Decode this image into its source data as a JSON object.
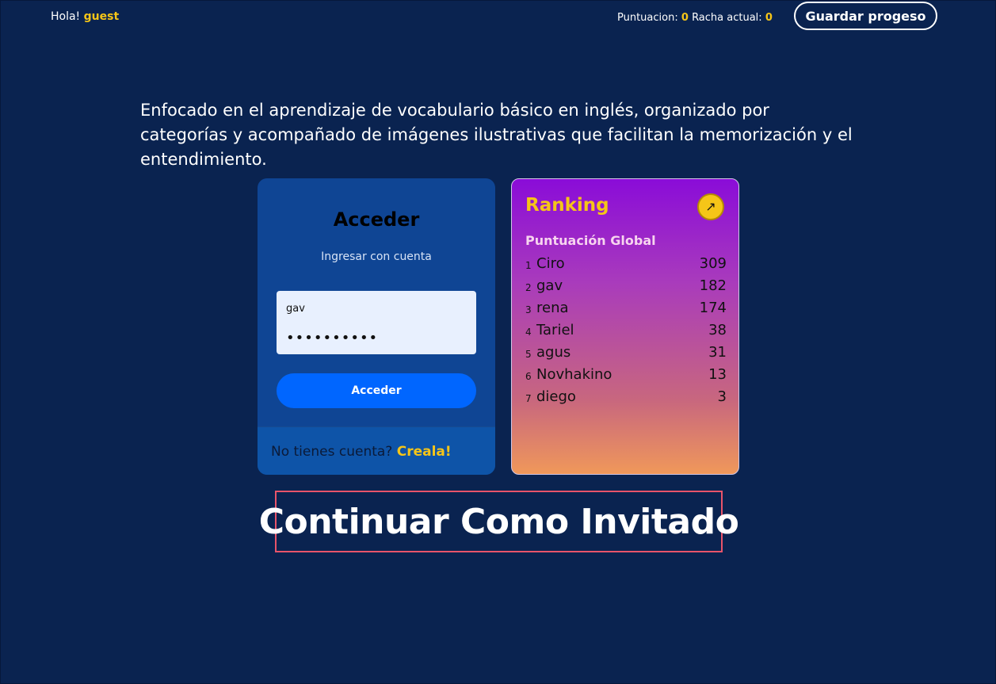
{
  "header": {
    "greeting_prefix": "Hola!",
    "username": "guest",
    "score_label": "Puntuacion:",
    "score_value": "0",
    "streak_label": "Racha actual:",
    "streak_value": "0",
    "save_label": "Guardar progeso"
  },
  "intro": {
    "text": "Enfocado en el aprendizaje de vocabulario básico en inglés, organizado por categorías y acompañado de imágenes ilustrativas que facilitan la memorización y el entendimiento."
  },
  "login": {
    "title": "Acceder",
    "subtitle": "Ingresar con cuenta",
    "username_value": "gav",
    "password_value": "••••••••••",
    "submit_label": "Acceder",
    "footer_text": "No tienes cuenta?",
    "footer_link": "Creala!"
  },
  "ranking": {
    "title": "Ranking",
    "open_icon": "arrow-up-right-icon",
    "subtitle": "Puntuación Global",
    "entries": [
      {
        "pos": "1",
        "name": "Ciro",
        "score": "309"
      },
      {
        "pos": "2",
        "name": "gav",
        "score": "182"
      },
      {
        "pos": "3",
        "name": "rena",
        "score": "174"
      },
      {
        "pos": "4",
        "name": "Tariel",
        "score": "38"
      },
      {
        "pos": "5",
        "name": "agus",
        "score": "31"
      },
      {
        "pos": "6",
        "name": "Novhakino",
        "score": "13"
      },
      {
        "pos": "7",
        "name": "diego",
        "score": "3"
      }
    ]
  },
  "guest": {
    "label": "Continuar Como Invitado"
  },
  "colors": {
    "background": "#0a2350",
    "accent": "#f5c518",
    "primary_button": "#0066ff",
    "guest_border": "#e8546a"
  }
}
